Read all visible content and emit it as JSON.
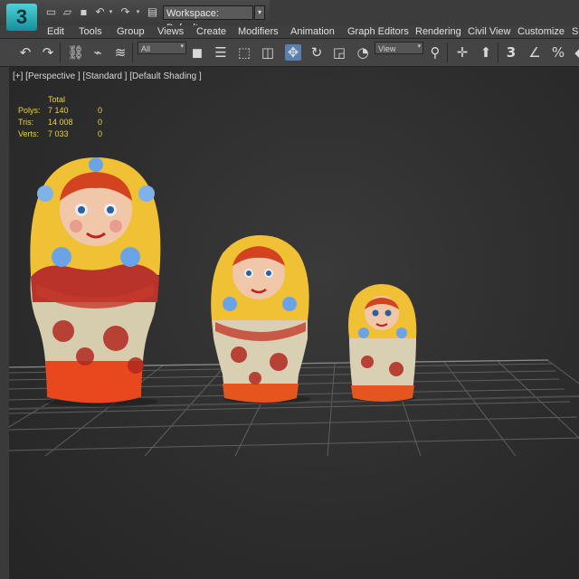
{
  "app": {
    "logo_text": "3"
  },
  "quick_access": {
    "icons": [
      "new-file-icon",
      "open-folder-icon",
      "save-icon",
      "undo-icon",
      "redo-icon",
      "project-icon"
    ],
    "workspace_label": "Workspace: Default"
  },
  "menu": {
    "items": [
      "Edit",
      "Tools",
      "Group",
      "Views",
      "Create",
      "Modifiers",
      "Animation",
      "Graph Editors",
      "Rendering",
      "Civil View",
      "Customize",
      "S"
    ]
  },
  "toolbar": {
    "selection_filter": "All",
    "reference_coord": "View",
    "icons": [
      "undo-icon",
      "redo-icon",
      "link-icon",
      "unlink-icon",
      "bind-spacewarp-icon",
      "select-object-icon",
      "select-by-name-icon",
      "rect-selection-icon",
      "window-crossing-icon",
      "move-icon",
      "rotate-icon",
      "scale-icon",
      "place-icon",
      "pivot-icon",
      "mirror-icon",
      "align-icon",
      "snap-3d-icon",
      "angle-snap-icon",
      "percent-snap-icon"
    ]
  },
  "viewport": {
    "label": "[+] [Perspective ] [Standard ] [Default Shading ]",
    "stats": {
      "header": "Total",
      "rows": [
        {
          "label": "Polys:",
          "total": "7 140",
          "selected": "0"
        },
        {
          "label": "Tris:",
          "total": "14 008",
          "selected": "0"
        },
        {
          "label": "Verts:",
          "total": "7 033",
          "selected": "0"
        }
      ]
    }
  },
  "colors": {
    "stats_text": "#e8d23a",
    "doll_yellow": "#f2c22e",
    "doll_red": "#c8281e",
    "doll_cream": "#e6ddc0",
    "doll_blue": "#6aa3e6",
    "active_tool": "#5b7fb0"
  }
}
